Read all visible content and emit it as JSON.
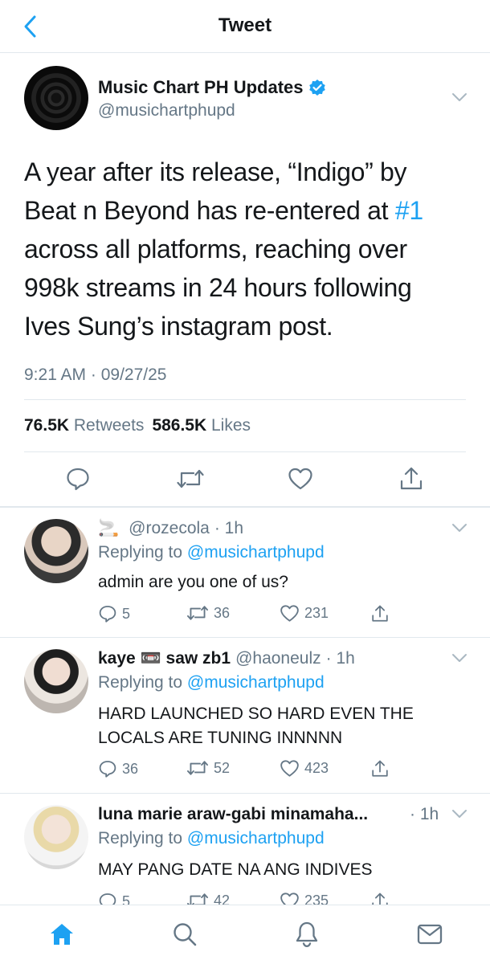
{
  "header": {
    "title": "Tweet"
  },
  "tweet": {
    "author_name": "Music Chart PH Updates",
    "handle": "@musichartphupd",
    "text_before": "A year after its release, “Indigo” by Beat n Beyond has re-entered at ",
    "hashtag": "#1",
    "text_after": " across all platforms, reaching over 998k streams in 24 hours following Ives Sung’s instagram post.",
    "time": "9:21 AM · 09/27/25",
    "retweets_count": "76.5K",
    "retweets_label": "Retweets",
    "likes_count": "586.5K",
    "likes_label": "Likes"
  },
  "replies": [
    {
      "name_emoji": "🚬",
      "name": "",
      "handle": "@rozecola",
      "time": "· 1h",
      "replying_prefix": "Replying to",
      "replying_handle": "@musichartphupd",
      "text": "admin are you one of us?",
      "reply_count": "5",
      "retweet_count": "36",
      "like_count": "231"
    },
    {
      "name_emoji": "",
      "name": "kaye 📼 saw zb1",
      "handle": "@haoneulz",
      "time": "· 1h",
      "replying_prefix": "Replying to",
      "replying_handle": "@musichartphupd",
      "text": "HARD LAUNCHED SO HARD EVEN THE LOCALS ARE TUNING INNNNN",
      "reply_count": "36",
      "retweet_count": "52",
      "like_count": "423"
    },
    {
      "name_emoji": "",
      "name": "luna marie araw-gabi minamaha...",
      "handle": "",
      "time": "· 1h",
      "replying_prefix": "Replying to",
      "replying_handle": "@musichartphupd",
      "text": "MAY PANG DATE NA ANG INDIVES",
      "reply_count": "5",
      "retweet_count": "42",
      "like_count": "235"
    }
  ],
  "icons": {
    "back": "chevron-left-icon",
    "verified": "verified-badge-icon",
    "reply": "speech-bubble-icon",
    "retweet": "retweet-icon",
    "like": "heart-icon",
    "share": "share-icon",
    "home": "home-icon",
    "search": "search-icon",
    "notifications": "bell-icon",
    "messages": "mail-icon"
  },
  "colors": {
    "accent": "#1da1f2",
    "muted": "#657786",
    "text": "#14171a",
    "divider": "#e1e8ed"
  }
}
